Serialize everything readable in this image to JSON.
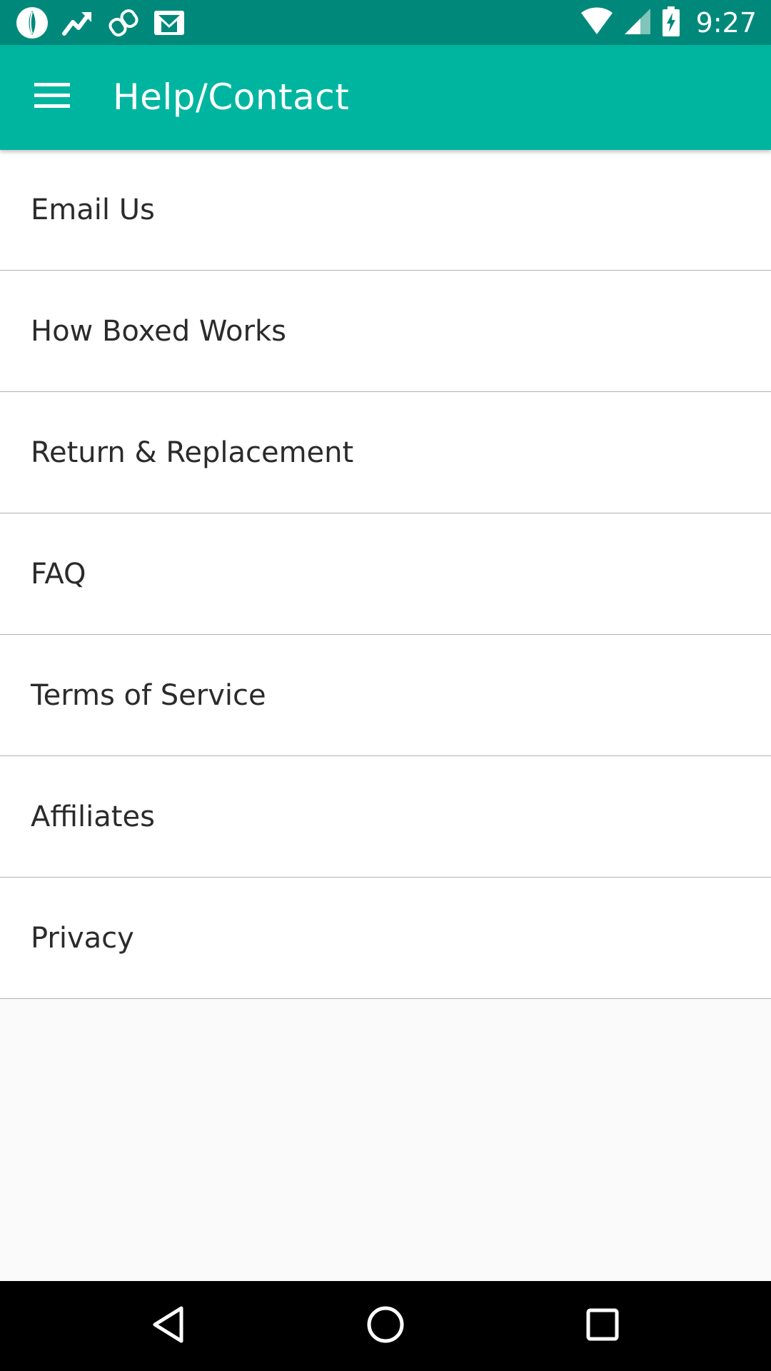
{
  "status_bar": {
    "time": "9:27",
    "left_icons": [
      "leaf-notification-icon",
      "trending-notification-icon",
      "link-notification-icon",
      "gmail-notification-icon"
    ],
    "right_icons": [
      "wifi-icon",
      "cell-signal-icon",
      "battery-charging-icon"
    ]
  },
  "app_bar": {
    "title": "Help/Contact",
    "menu_icon": "hamburger-menu-icon",
    "background_color": "#00b5a0",
    "status_color": "#00897b"
  },
  "menu": {
    "items": [
      {
        "label": "Email Us"
      },
      {
        "label": "How Boxed Works"
      },
      {
        "label": "Return & Replacement"
      },
      {
        "label": "FAQ"
      },
      {
        "label": "Terms of Service"
      },
      {
        "label": "Affiliates"
      },
      {
        "label": "Privacy"
      }
    ]
  },
  "nav_bar": {
    "buttons": [
      "back-icon",
      "home-icon",
      "recents-icon"
    ]
  }
}
